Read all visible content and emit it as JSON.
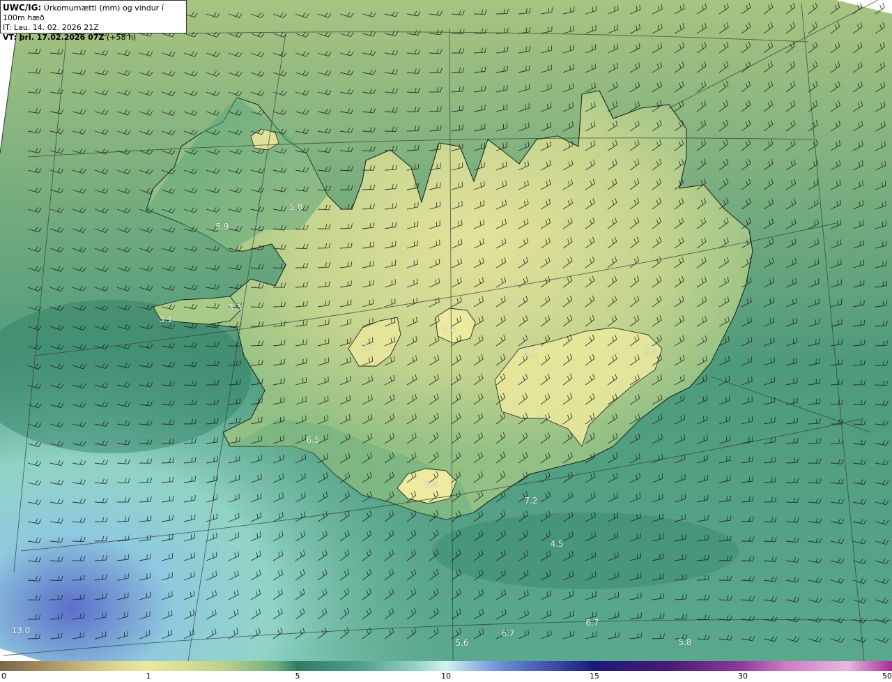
{
  "header": {
    "model": "UWC/IG:",
    "title": "Úrkomumætti (mm) og vindur í 100m hæð",
    "it_line": "IT: Lau. 14. 02. 2026 21Z",
    "vt_label": "VT: þri. 17.02.2026 07Z",
    "vt_offset": "(+58 h)"
  },
  "colorbar": {
    "ticks": [
      {
        "value": 0,
        "label": "0"
      },
      {
        "value": 1,
        "label": "1"
      },
      {
        "value": 5,
        "label": "5"
      },
      {
        "value": 10,
        "label": "10"
      },
      {
        "value": 15,
        "label": "15"
      },
      {
        "value": 30,
        "label": "30"
      },
      {
        "value": 50,
        "label": "50"
      }
    ],
    "colors": [
      "#7a6648",
      "#a98f62",
      "#d8cf8c",
      "#eee89e",
      "#bcd189",
      "#6fae7d",
      "#2f7d63",
      "#4d9c86",
      "#99d7c8",
      "#d2f3ef",
      "#6d8fd8",
      "#3d4ca8",
      "#1a1a78",
      "#4b1a78",
      "#8b3a9b",
      "#cf79c5",
      "#e7b9e0",
      "#aa2a99"
    ],
    "stops": [
      0,
      0.05,
      0.12,
      0.166,
      0.25,
      0.31,
      0.333,
      0.4,
      0.47,
      0.5,
      0.56,
      0.62,
      0.666,
      0.75,
      0.83,
      0.88,
      0.95,
      1.0
    ]
  },
  "map_labels": [
    {
      "text": "5.8"
    },
    {
      "text": "5.9"
    },
    {
      "text": "3.3"
    },
    {
      "text": "3.1"
    },
    {
      "text": "2.4"
    },
    {
      "text": "2.4"
    },
    {
      "text": "2.1"
    },
    {
      "text": "2.1"
    },
    {
      "text": "6.5"
    },
    {
      "text": "1.6"
    },
    {
      "text": "7.2"
    },
    {
      "text": "4.5"
    },
    {
      "text": "13.0"
    },
    {
      "text": "5.6"
    },
    {
      "text": "6.7"
    },
    {
      "text": "6.7"
    },
    {
      "text": "5.8"
    }
  ]
}
